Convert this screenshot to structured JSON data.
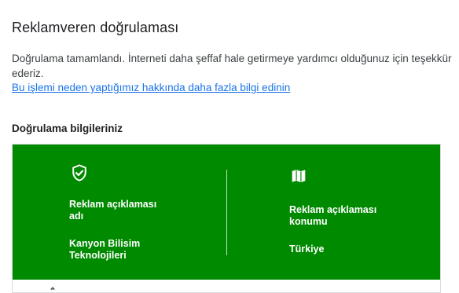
{
  "header": {
    "title": "Reklamveren doğrulaması"
  },
  "intro": {
    "text": "Doğrulama tamamlandı. İnterneti daha şeffaf hale getirmeye yardımcı olduğunuz için teşekkür ederiz.",
    "link_text": "Bu işlemi neden yaptığımız hakkında daha fazla bilgi edinin"
  },
  "info_section": {
    "heading": "Doğrulama bilgileriniz",
    "card_color": "#008a00",
    "items": [
      {
        "icon": "verified-shield-icon",
        "label": "Reklam açıklaması adı",
        "value": "Kanyon Bilisim Teknolojileri"
      },
      {
        "icon": "map-icon",
        "label": "Reklam açıklaması konumu",
        "value": "Türkiye"
      }
    ]
  }
}
